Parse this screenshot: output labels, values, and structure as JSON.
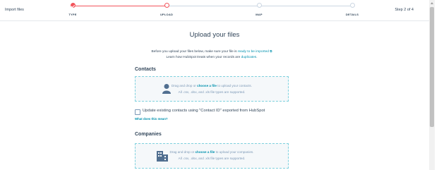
{
  "header": {
    "title": "Import files",
    "step_indicator": "Step 2 of 4",
    "steps": [
      {
        "label": "TYPE",
        "status": "complete"
      },
      {
        "label": "UPLOAD",
        "status": "current"
      },
      {
        "label": "MAP",
        "status": "upcoming"
      },
      {
        "label": "DETAILS",
        "status": "upcoming"
      }
    ]
  },
  "main": {
    "heading": "Upload your files",
    "info_line1_prefix": "Before you upload your files below, make sure your file is ",
    "info_line1_link": "ready to be imported",
    "info_line2_prefix": "Learn how HubSpot treats when your records are ",
    "info_line2_link": "duplicates",
    "info_line2_suffix": "."
  },
  "contacts": {
    "title": "Contacts",
    "drop_prefix": "Drag and drop or ",
    "drop_link": "choose a file",
    "drop_suffix": " to upload your contacts.",
    "file_types": "All .csv, .xlsx, and .xls file types are supported.",
    "icon": "person-icon",
    "update_checkbox_label": "Update existing contacts using \"Contact ID\" exported from HubSpot",
    "update_checked": false,
    "help_link": "What does this mean?"
  },
  "companies": {
    "title": "Companies",
    "drop_prefix": "Drag and drop or ",
    "drop_link": "choose a file",
    "drop_suffix": " to upload your companies.",
    "file_types": "All .csv, .xlsx, and .xls file types are supported.",
    "icon": "building-icon"
  },
  "colors": {
    "accent": "#f2545b",
    "link": "#0091ae",
    "text": "#33475b",
    "dropzone_bg": "#f5f8fa",
    "dropzone_border": "#7fd1de"
  }
}
